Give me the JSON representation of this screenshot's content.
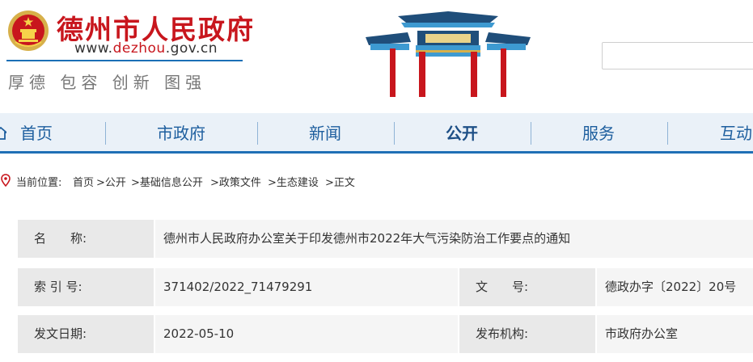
{
  "header": {
    "site_title": "德州市人民政府",
    "url_prefix": "www.",
    "url_highlight": "dezhou",
    "url_suffix": ".gov.cn",
    "slogan": "厚德 包容 创新 图强"
  },
  "search": {
    "placeholder": ""
  },
  "nav": {
    "items": [
      {
        "label": "首页"
      },
      {
        "label": "市政府"
      },
      {
        "label": "新闻"
      },
      {
        "label": "公开"
      },
      {
        "label": "服务"
      },
      {
        "label": "互动"
      }
    ],
    "active": "公开"
  },
  "breadcrumb": {
    "prefix": "当前位置:",
    "items": [
      "首页",
      ">公开",
      ">基础信息公开",
      ">政策文件",
      ">生态建设",
      ">正文"
    ]
  },
  "info": {
    "name_label": "名　　称:",
    "name_value": "德州市人民政府办公室关于印发德州市2022年大气污染防治工作要点的通知",
    "index_label": "索 引 号:",
    "index_value": "371402/2022_71479291",
    "docno_label": "文　　号:",
    "docno_value": "德政办字〔2022〕20号",
    "date_label": "发文日期:",
    "date_value": "2022-05-10",
    "org_label": "发布机构:",
    "org_value": "市政府办公室"
  },
  "colors": {
    "brand_red": "#c8161d",
    "nav_blue": "#1f6fb5",
    "nav_bg": "#eaf1f8"
  }
}
